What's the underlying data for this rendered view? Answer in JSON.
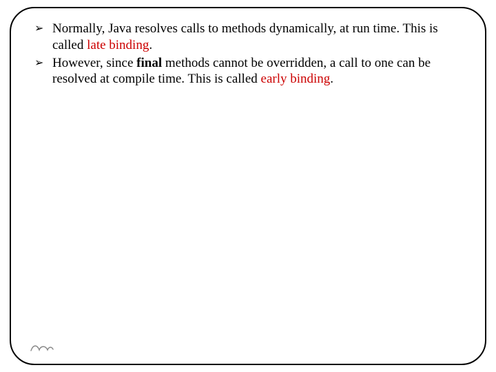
{
  "bullets": [
    {
      "pre": "Normally, Java resolves calls to methods dynamically, at run time. This is called ",
      "em": "late binding",
      "post": "."
    },
    {
      "pre": "However, since ",
      "kw": "final",
      "mid": " methods cannot be overridden, a call to one can be resolved at compile time. This is called ",
      "em": "early binding",
      "post": "."
    }
  ]
}
